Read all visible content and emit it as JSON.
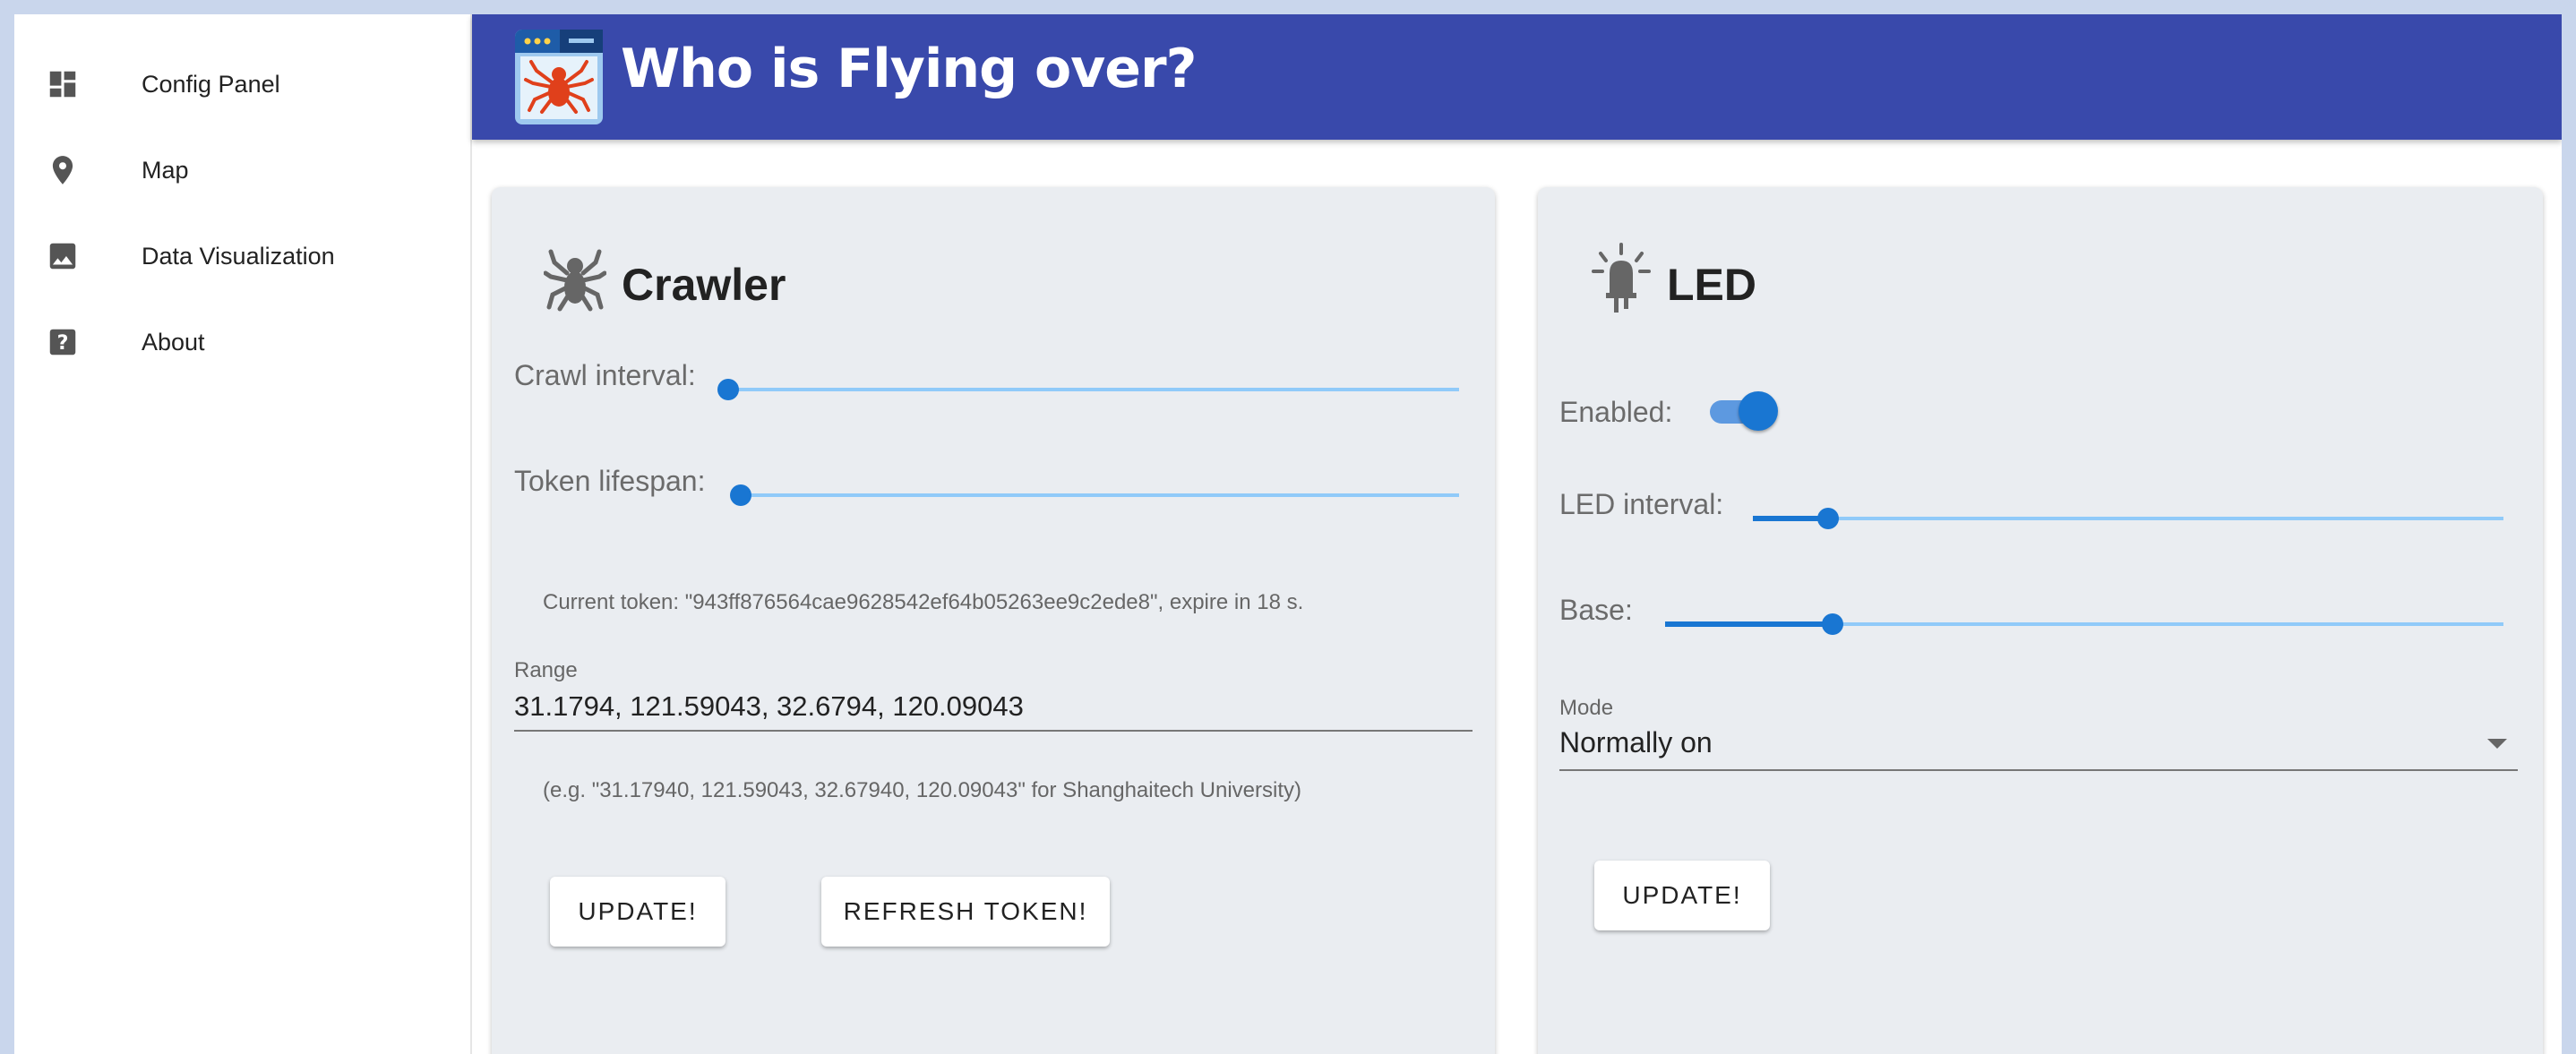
{
  "app": {
    "title": "Who is Flying over?"
  },
  "sidebar": {
    "items": [
      {
        "label": "Config Panel",
        "icon": "dashboard-icon"
      },
      {
        "label": "Map",
        "icon": "map-pin-icon"
      },
      {
        "label": "Data Visualization",
        "icon": "image-icon"
      },
      {
        "label": "About",
        "icon": "help-icon"
      }
    ]
  },
  "crawler": {
    "title": "Crawler",
    "icon": "spider-icon",
    "crawl_interval": {
      "label": "Crawl interval:",
      "value_fraction": 0.0
    },
    "token_lifespan": {
      "label": "Token lifespan:",
      "value_fraction": 0.0
    },
    "current_token_text": "Current token: \"943ff876564cae9628542ef64b05263ee9c2ede8\", expire in 18 s.",
    "range": {
      "label": "Range",
      "value": "31.1794, 121.59043, 32.6794, 120.09043",
      "helper": "(e.g. \"31.17940, 121.59043, 32.67940, 120.09043\" for Shanghaitech University)"
    },
    "update_label": "UPDATE!",
    "refresh_label": "REFRESH TOKEN!"
  },
  "led": {
    "title": "LED",
    "icon": "led-bulb-icon",
    "enabled": {
      "label": "Enabled:",
      "on": true
    },
    "led_interval": {
      "label": "LED interval:",
      "value_fraction": 0.1
    },
    "base": {
      "label": "Base:",
      "value_fraction": 0.2
    },
    "mode": {
      "label": "Mode",
      "value": "Normally on"
    },
    "update_label": "UPDATE!"
  },
  "colors": {
    "appbar": "#3949ab",
    "accent": "#1976d2",
    "track": "#90caf9",
    "card": "#eaedf1"
  }
}
